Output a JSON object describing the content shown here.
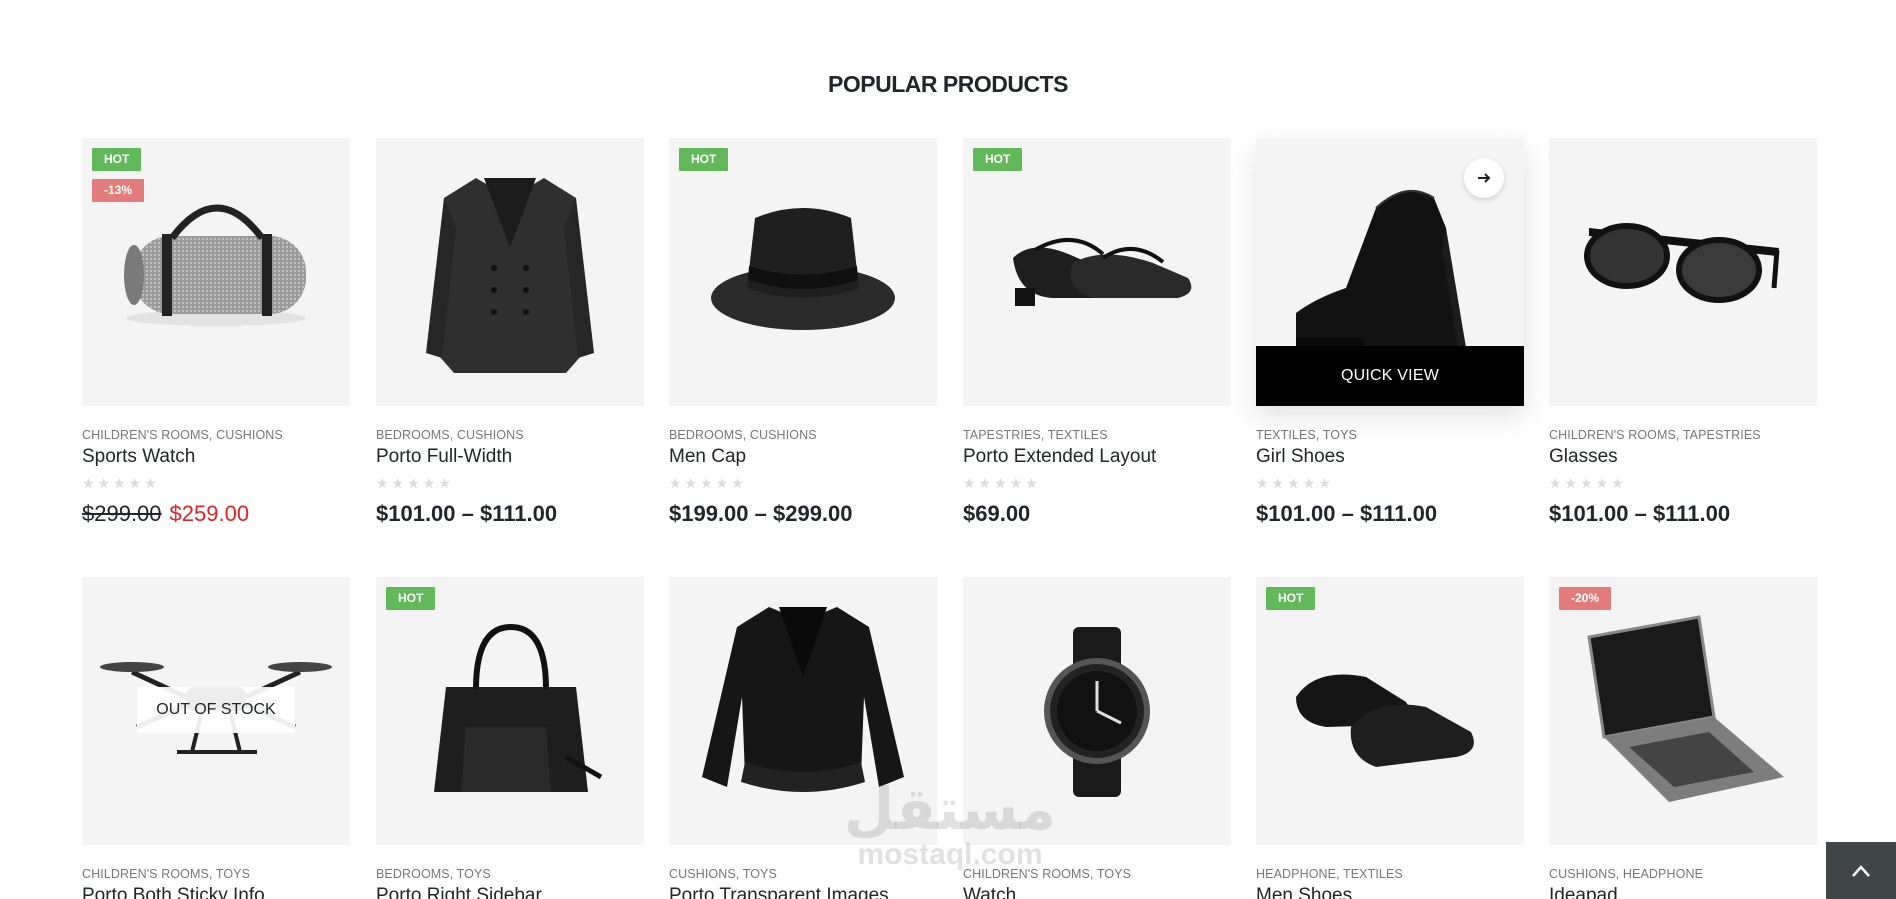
{
  "section": {
    "title": "POPULAR PRODUCTS"
  },
  "quick_view_label": "QUICK VIEW",
  "stars": "★★★★★",
  "products": [
    {
      "image": "duffel-bag",
      "labels": [
        "HOT",
        "-13%"
      ],
      "categories": "CHILDREN'S ROOMS, CUSHIONS",
      "name": "Sports Watch",
      "old_price": "$299.00",
      "price": "$259.00"
    },
    {
      "image": "coat",
      "labels": [],
      "categories": "BEDROOMS, CUSHIONS",
      "name": "Porto Full-Width",
      "price": "$101.00 – $111.00"
    },
    {
      "image": "hat",
      "labels": [
        "HOT"
      ],
      "categories": "BEDROOMS, CUSHIONS",
      "name": "Men Cap",
      "price": "$199.00 – $299.00"
    },
    {
      "image": "girl-shoes",
      "labels": [
        "HOT"
      ],
      "categories": "TAPESTRIES, TEXTILES",
      "name": "Porto Extended Layout",
      "price": "$69.00"
    },
    {
      "image": "high-heel",
      "labels": [],
      "categories": "TEXTILES, TOYS",
      "name": "Girl Shoes",
      "price": "$101.00 – $111.00"
    },
    {
      "image": "sunglasses",
      "labels": [],
      "categories": "CHILDREN'S ROOMS, TAPESTRIES",
      "name": "Glasses",
      "price": "$101.00 – $111.00"
    },
    {
      "image": "drone",
      "labels": [],
      "out_of_stock": "OUT OF STOCK",
      "categories": "CHILDREN'S ROOMS, TOYS",
      "name": "Porto Both Sticky Info"
    },
    {
      "image": "handbag",
      "labels": [
        "HOT"
      ],
      "categories": "BEDROOMS, TOYS",
      "name": "Porto Right Sidebar"
    },
    {
      "image": "jacket",
      "labels": [],
      "categories": "CUSHIONS, TOYS",
      "name": "Porto Transparent Images"
    },
    {
      "image": "watch",
      "labels": [],
      "categories": "CHILDREN'S ROOMS, TOYS",
      "name": "Watch"
    },
    {
      "image": "men-shoes",
      "labels": [
        "HOT"
      ],
      "categories": "HEADPHONE, TEXTILES",
      "name": "Men Shoes"
    },
    {
      "image": "laptop",
      "labels": [
        "-20%"
      ],
      "categories": "CUSHIONS, HEADPHONE",
      "name": "Ideapad"
    }
  ],
  "watermark": {
    "arabic": "مستقل",
    "latin": "mostaql.com"
  },
  "colors": {
    "hot": "#62b959",
    "sale": "#e27c7c",
    "sale_price": "#e52222",
    "text": "#222529",
    "muted": "#777777"
  }
}
